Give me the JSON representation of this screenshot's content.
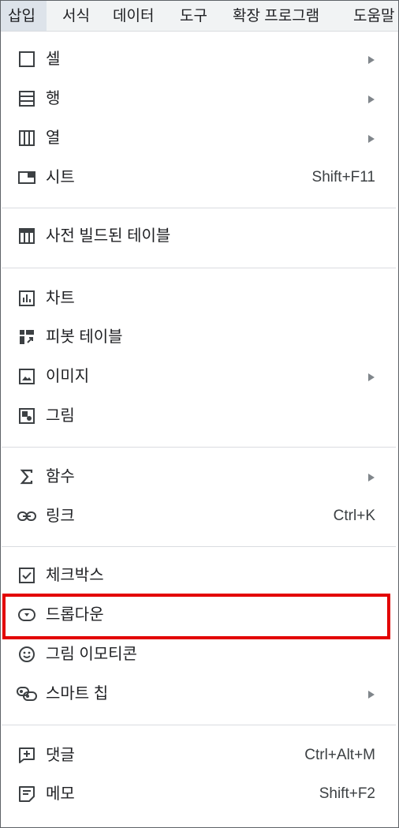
{
  "menubar": {
    "items": [
      "삽입",
      "서식",
      "데이터",
      "도구",
      "확장 프로그램",
      "도움말"
    ],
    "active": "삽입"
  },
  "menu": {
    "items": [
      {
        "label": "셀",
        "icon": "cell-icon",
        "submenu": true
      },
      {
        "label": "행",
        "icon": "rows-icon",
        "submenu": true
      },
      {
        "label": "열",
        "icon": "columns-icon",
        "submenu": true
      },
      {
        "label": "시트",
        "icon": "sheet-icon",
        "shortcut": "Shift+F11"
      },
      {
        "label": "사전 빌드된 테이블",
        "icon": "table-icon"
      },
      {
        "label": "차트",
        "icon": "chart-icon"
      },
      {
        "label": "피봇 테이블",
        "icon": "pivot-table-icon"
      },
      {
        "label": "이미지",
        "icon": "image-icon",
        "submenu": true
      },
      {
        "label": "그림",
        "icon": "drawing-icon"
      },
      {
        "label": "함수",
        "icon": "sigma-icon",
        "submenu": true
      },
      {
        "label": "링크",
        "icon": "link-icon",
        "shortcut": "Ctrl+K"
      },
      {
        "label": "체크박스",
        "icon": "checkbox-icon"
      },
      {
        "label": "드롭다운",
        "icon": "dropdown-icon"
      },
      {
        "label": "그림 이모티콘",
        "icon": "emoji-icon"
      },
      {
        "label": "스마트 칩",
        "icon": "smart-chip-icon",
        "submenu": true
      },
      {
        "label": "댓글",
        "icon": "comment-icon",
        "shortcut": "Ctrl+Alt+M"
      },
      {
        "label": "메모",
        "icon": "note-icon",
        "shortcut": "Shift+F2"
      }
    ]
  },
  "highlight": {
    "target": "드롭다운",
    "color": "#e30000"
  },
  "colors": {
    "text": "#202124",
    "icon": "#3c4043",
    "separator": "#dadce0",
    "menubar_bg": "#f1f3f4"
  }
}
